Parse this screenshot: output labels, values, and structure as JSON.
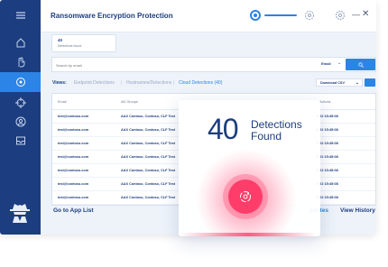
{
  "app": {
    "title": "Ransomware Encryption Protection"
  },
  "stat_card": {
    "count": "40",
    "label": "Detections found"
  },
  "search": {
    "placeholder": "Search by email",
    "field_select": "Email",
    "button_icon": "search-icon"
  },
  "views": {
    "label": "Views:",
    "tabs": [
      {
        "label": "Endpoint Detections"
      },
      {
        "label": "Hostnames/Detections"
      },
      {
        "label": "Cloud Detections (40)"
      }
    ],
    "download_select": "Download CSV"
  },
  "table": {
    "headers": [
      "Email",
      "AD Groups",
      "Actions"
    ],
    "rows": [
      {
        "email": "test@contoso.com",
        "groups": "AAX Contoso, Contoso, CLF Test",
        "date": "2022 15:45:08"
      },
      {
        "email": "test@contoso.com",
        "groups": "AAX Contoso, Contoso, CLF Test",
        "date": "2022 15:45:08"
      },
      {
        "email": "test@contoso.com",
        "groups": "AAX Contoso, Contoso, CLF Test",
        "date": "2022 15:45:08"
      },
      {
        "email": "test@contoso.com",
        "groups": "AAX Contoso, Contoso, CLF Test",
        "date": "2022 15:45:08"
      },
      {
        "email": "test@contoso.com",
        "groups": "AAX Contoso, Contoso, CLF Test",
        "date": "2022 15:45:08"
      },
      {
        "email": "test@contoso.com",
        "groups": "AAX Contoso, Contoso, CLF Test",
        "date": "2022 15:45:08"
      },
      {
        "email": "test@contoso.com",
        "groups": "AAX Contoso, Contoso, CLF Test",
        "date": "2022 15:45:08"
      }
    ]
  },
  "footer": {
    "link": "Go to App List",
    "updates": "pdates",
    "history": "View History"
  },
  "overlay": {
    "count": "40",
    "label_line1": "Detections",
    "label_line2": "Found"
  },
  "colors": {
    "sidebar": "#1c3d7f",
    "accent": "#2c84e6",
    "alert": "#ff3d6a"
  },
  "sidebar_icons": [
    "menu-icon",
    "home-icon",
    "hand-icon",
    "target-icon",
    "crosshair-icon",
    "user-icon",
    "inbox-icon",
    "spy-logo"
  ]
}
